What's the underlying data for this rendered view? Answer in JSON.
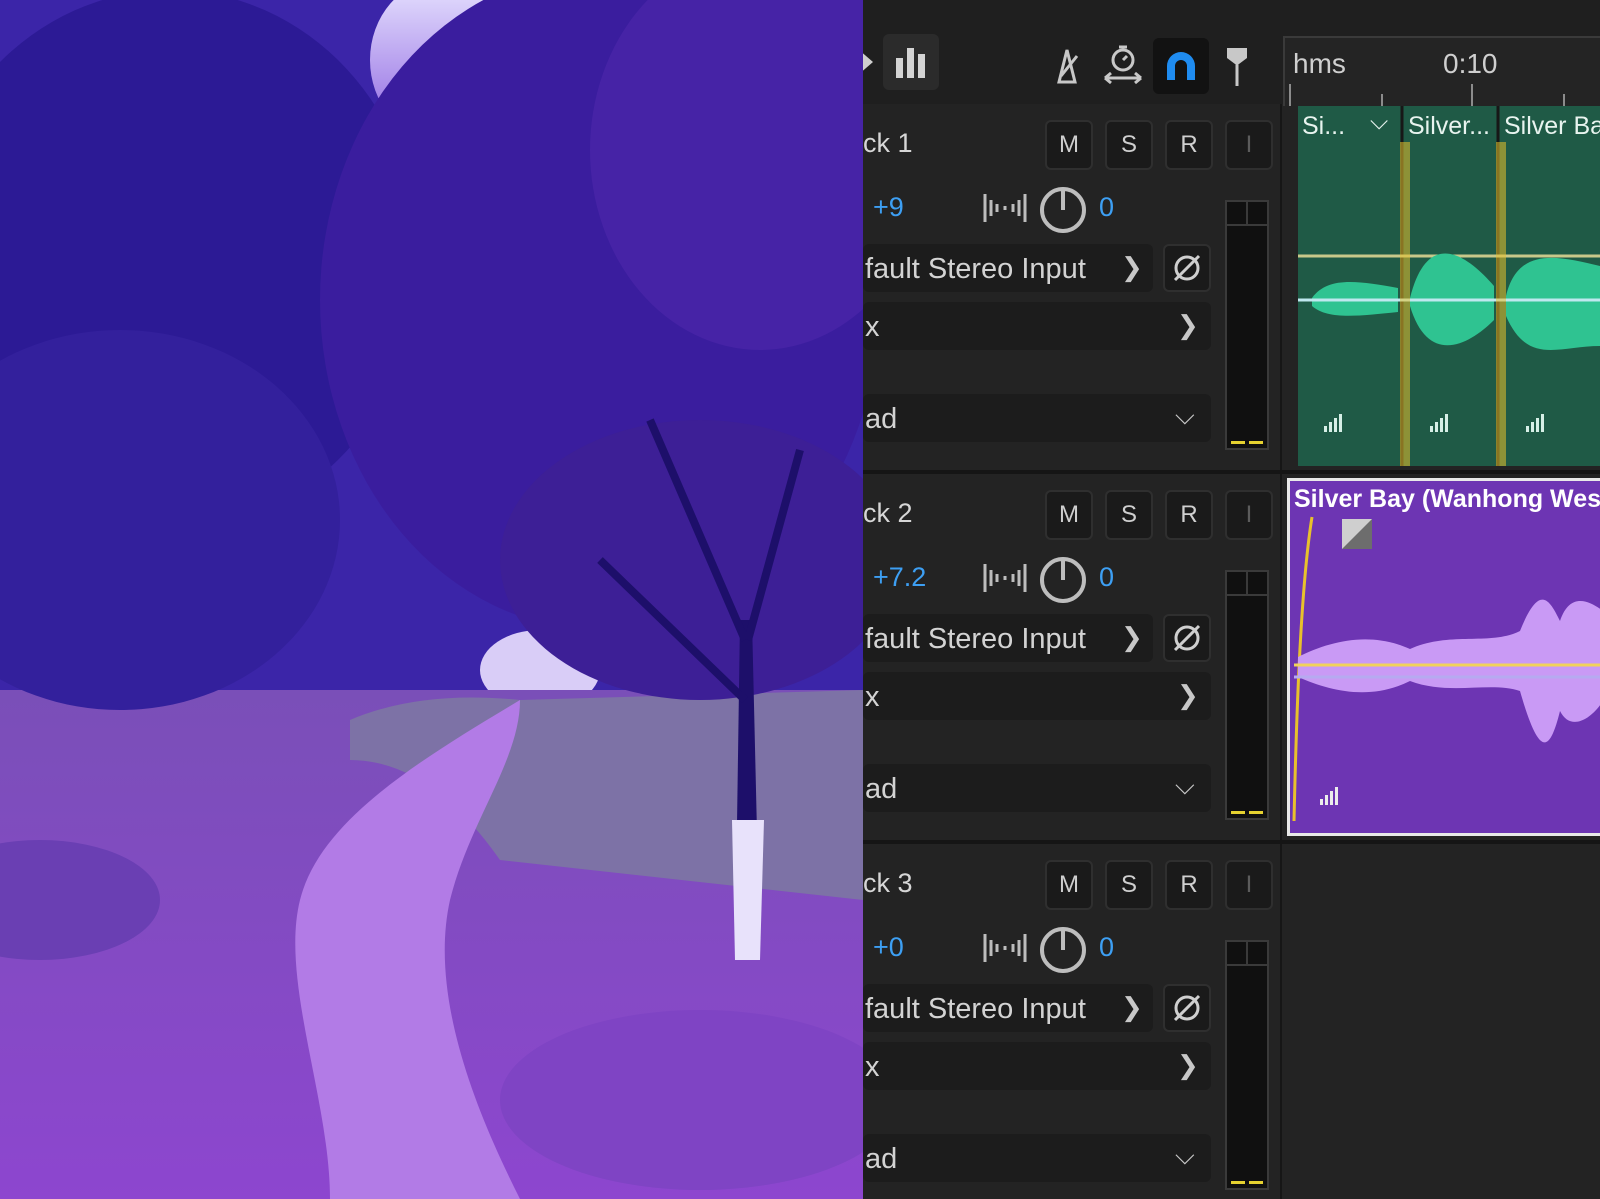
{
  "toolbar": {
    "icons": [
      "partial-icon",
      "levels-icon",
      "metronome-icon",
      "timer-icon",
      "snap-magnet-icon",
      "marker-pin-icon"
    ],
    "active_color": "#1f8cf0"
  },
  "ruler": {
    "unit_label": "hms",
    "time_label": "0:10"
  },
  "tracks": [
    {
      "name": "ck 1",
      "buttons": [
        "M",
        "S",
        "R",
        "I"
      ],
      "volume": "+9",
      "pan": "0",
      "input": "fault Stereo Input",
      "fx": "x",
      "output": "ad"
    },
    {
      "name": "ck 2",
      "buttons": [
        "M",
        "S",
        "R",
        "I"
      ],
      "volume": "+7.2",
      "pan": "0",
      "input": "fault Stereo Input",
      "fx": "x",
      "output": "ad"
    },
    {
      "name": "ck 3",
      "buttons": [
        "M",
        "S",
        "R",
        "I"
      ],
      "volume": "+0",
      "pan": "0",
      "input": "fault Stereo Input",
      "fx": "x",
      "output": "ad"
    }
  ],
  "clips": {
    "track1": [
      "Si...",
      "Silver...",
      "Silver Ba"
    ],
    "track2": "Silver Bay (Wanhong West S"
  },
  "colors": {
    "value_blue": "#3d9ff3",
    "clip_green": "#1f5a46",
    "waveform_green": "#2fc391",
    "clip_purple": "#6d35b3",
    "waveform_purple": "#c99af5",
    "fade_yellow": "#e8c12c"
  }
}
